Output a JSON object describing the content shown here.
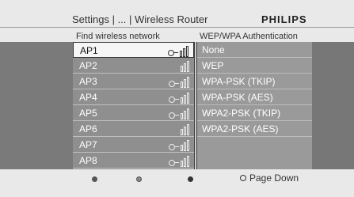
{
  "header": {
    "breadcrumb": "Settings | ... | Wireless Router",
    "brand": "PHILIPS"
  },
  "columns": {
    "left_title": "Find wireless network",
    "right_title": "WEP/WPA Authentication"
  },
  "networks": [
    {
      "label": "AP1",
      "secured": true,
      "signal": 3,
      "selected": true
    },
    {
      "label": "AP2",
      "secured": false,
      "signal": 3,
      "selected": false
    },
    {
      "label": "AP3",
      "secured": true,
      "signal": 3,
      "selected": false
    },
    {
      "label": "AP4",
      "secured": true,
      "signal": 3,
      "selected": false
    },
    {
      "label": "AP5",
      "secured": true,
      "signal": 3,
      "selected": false
    },
    {
      "label": "AP6",
      "secured": false,
      "signal": 3,
      "selected": false
    },
    {
      "label": "AP7",
      "secured": true,
      "signal": 3,
      "selected": false
    },
    {
      "label": "AP8",
      "secured": true,
      "signal": 3,
      "selected": false
    }
  ],
  "auth_options": [
    "None",
    "WEP",
    "WPA-PSK (TKIP)",
    "WPA-PSK (AES)",
    "WPA2-PSK (TKIP)",
    "WPA2-PSK (AES)"
  ],
  "footer": {
    "page_down": "Page Down"
  }
}
